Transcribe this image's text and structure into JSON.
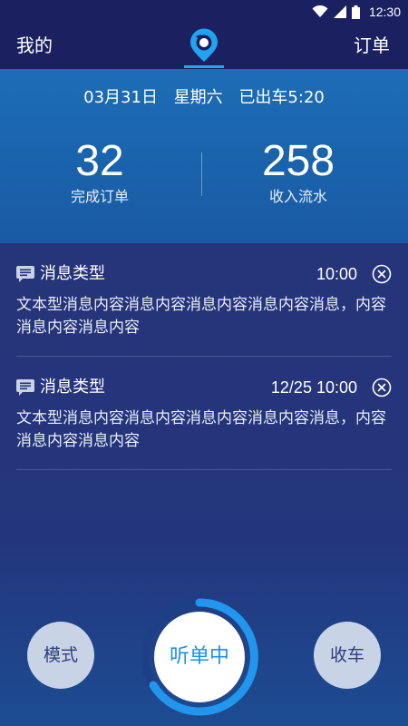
{
  "status_bar": {
    "time": "12:30",
    "icons": [
      "wifi-icon",
      "signal-icon",
      "battery-icon"
    ]
  },
  "nav": {
    "left_label": "我的",
    "right_label": "订单",
    "logo_icon": "location-logo-icon",
    "accent_color": "#22a3f0"
  },
  "summary": {
    "date": "03月31日",
    "weekday": "星期六",
    "departure": "已出车5:20",
    "stats": [
      {
        "value": "32",
        "label": "完成订单"
      },
      {
        "value": "258",
        "label": "收入流水"
      }
    ]
  },
  "messages": [
    {
      "icon": "message-icon",
      "type": "消息类型",
      "time": "10:00",
      "body": "文本型消息内容消息内容消息内容消息内容消息，内容消息内容消息内容"
    },
    {
      "icon": "message-icon",
      "type": "消息类型",
      "time": "12/25 10:00",
      "body": "文本型消息内容消息内容消息内容消息内容消息，内容消息内容消息内容"
    }
  ],
  "controls": {
    "mode_label": "模式",
    "listen_label": "听单中",
    "stop_label": "收车",
    "listen_color": "#1f8fe6"
  }
}
